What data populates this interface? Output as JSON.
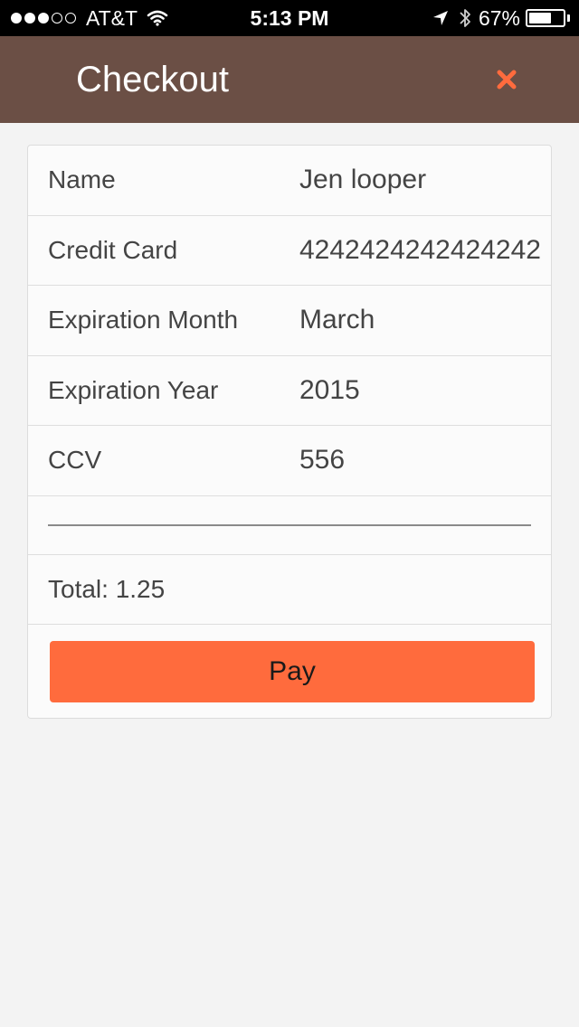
{
  "status_bar": {
    "carrier": "AT&T",
    "time": "5:13 PM",
    "battery": "67%",
    "battery_level": 0.67,
    "signal_bars": 3,
    "signal_total": 5
  },
  "header": {
    "title": "Checkout",
    "close_icon": "close-icon",
    "accent_color": "#ff6b3d",
    "background_color": "#6b4f45"
  },
  "form": {
    "name": {
      "label": "Name",
      "value": "Jen looper"
    },
    "credit_card": {
      "label": "Credit Card",
      "value": "4242424242424242"
    },
    "expiration_month": {
      "label": "Expiration Month",
      "value": "March"
    },
    "expiration_year": {
      "label": "Expiration Year",
      "value": "2015"
    },
    "ccv": {
      "label": "CCV",
      "value": "556"
    },
    "total": "Total: 1.25",
    "pay_label": "Pay"
  }
}
